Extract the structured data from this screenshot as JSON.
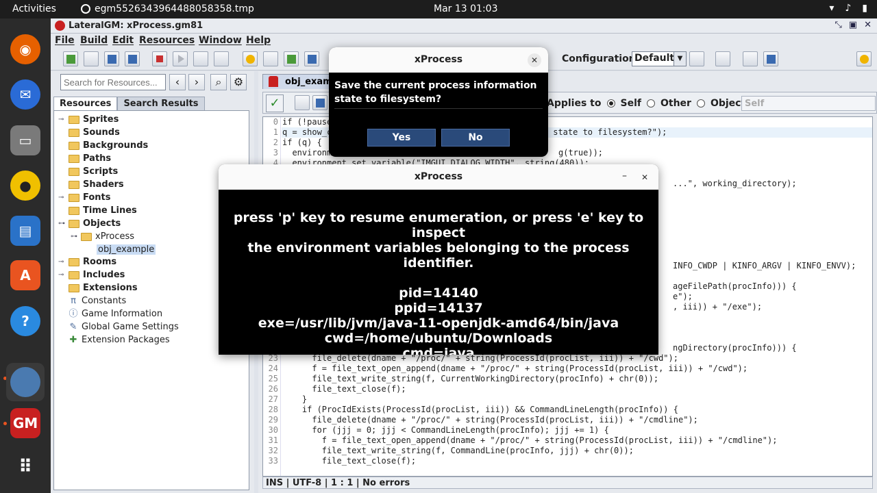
{
  "topbar": {
    "activities": "Activities",
    "app_name": "egm5526343964488058358.tmp",
    "clock": "Mar 13  01:03"
  },
  "dock": {
    "items": [
      "firefox-icon",
      "thunderbird-icon",
      "files-icon",
      "rhythmbox-icon",
      "writer-icon",
      "appcenter-icon",
      "help-icon",
      "gamemaker-icon",
      "lateralgm-icon",
      "apps-grid-icon"
    ]
  },
  "window": {
    "title": "LateralGM: xProcess.gm81"
  },
  "menu": {
    "file": "File",
    "build": "Build",
    "edit": "Edit",
    "resources": "Resources",
    "window": "Window",
    "help": "Help"
  },
  "toolbar": {
    "config_label": "Configuration:",
    "config_value": "Default"
  },
  "left": {
    "search_placeholder": "Search for Resources...",
    "tab_resources": "Resources",
    "tab_search": "Search Results",
    "tree": {
      "sprites": "Sprites",
      "sounds": "Sounds",
      "backgrounds": "Backgrounds",
      "paths": "Paths",
      "scripts": "Scripts",
      "shaders": "Shaders",
      "fonts": "Fonts",
      "timelines": "Time Lines",
      "objects": "Objects",
      "xprocess": "xProcess",
      "obj_example": "obj_example",
      "rooms": "Rooms",
      "includes": "Includes",
      "extensions": "Extensions",
      "constants": "Constants",
      "game_info": "Game Information",
      "global_settings": "Global Game Settings",
      "ext_packages": "Extension Packages"
    }
  },
  "editor": {
    "tab": "obj_examp",
    "applies_to": "Applies to",
    "self": "Self",
    "other": "Other",
    "object": "Object:",
    "object_value": "Self",
    "status": "INS | UTF-8 | 1 : 1 | No errors"
  },
  "code": {
    "l0_a": "if (!pause",
    "l1_a": "q = show_c",
    "l1_b": " state to filesystem?\");",
    "l2_a": "if (q) {",
    "l3_a": "  environm",
    "l3_b": "g(true));",
    "l4_a": "  environment_set_variable(\"IMGUI_DIALOG_WIDTH\", string(480));",
    "l6_b": "...\", working_directory);",
    "l14_b": "INFO_CWDP | KINFO_ARGV | KINFO_ENVV);",
    "l16_b": "ageFilePath(procInfo))) {",
    "l17_b": "e\");",
    "l18_b": ", iii)) + \"/exe\");",
    "l22_b": "ngDirectory(procInfo))) {",
    "l23": "      file_delete(dname + \"/proc/\" + string(ProcessId(procList, iii)) + \"/cwd\");",
    "l24": "      f = file_text_open_append(dname + \"/proc/\" + string(ProcessId(procList, iii)) + \"/cwd\");",
    "l25": "      file_text_write_string(f, CurrentWorkingDirectory(procInfo) + chr(0));",
    "l26": "      file_text_close(f);",
    "l27": "    }",
    "l28": "    if (ProcIdExists(ProcessId(procList, iii)) && CommandLineLength(procInfo)) {",
    "l29": "      file_delete(dname + \"/proc/\" + string(ProcessId(procList, iii)) + \"/cmdline\");",
    "l30": "      for (jjj = 0; jjj < CommandLineLength(procInfo); jjj += 1) {",
    "l31": "        f = file_text_open_append(dname + \"/proc/\" + string(ProcessId(procList, iii)) + \"/cmdline\");",
    "l32": "        file_text_write_string(f, CommandLine(procInfo, jjj) + chr(0));",
    "l33": "        file_text_close(f);"
  },
  "dialog_save": {
    "title": "xProcess",
    "message": "Save the current process information state to filesystem?",
    "yes": "Yes",
    "no": "No"
  },
  "dialog_info": {
    "title": "xProcess",
    "line1": "press 'p' key to resume enumeration, or press 'e' key to inspect",
    "line2": "the environment variables belonging to the process identifier.",
    "pid": "pid=14140",
    "ppid": "ppid=14137",
    "exe": "exe=/usr/lib/jvm/java-11-openjdk-amd64/bin/java",
    "cwd": "cwd=/home/ubuntu/Downloads",
    "cmd": "cmd=java"
  }
}
